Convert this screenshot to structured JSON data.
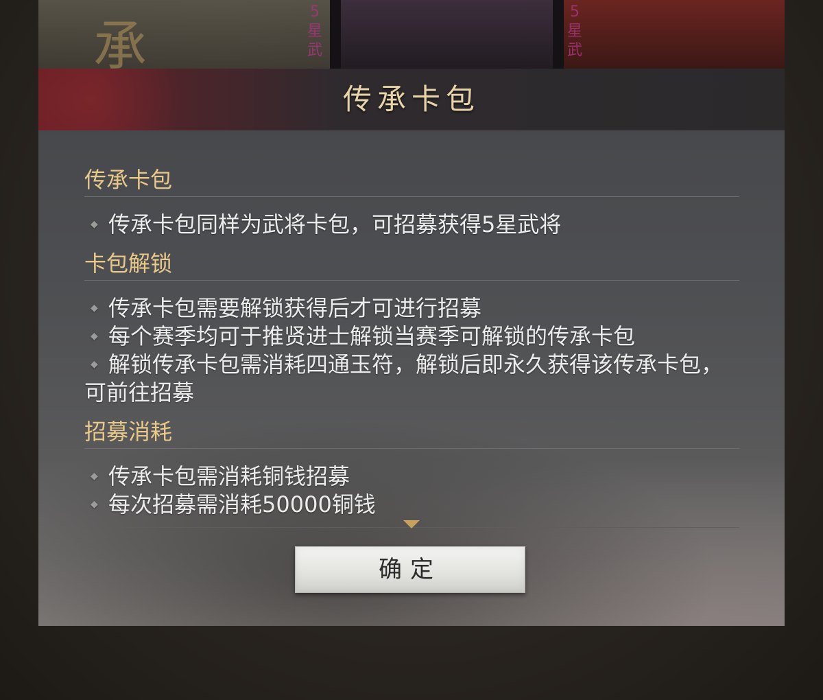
{
  "background": {
    "art_big_char": "承",
    "art_side_text_1": "5星武",
    "art_side_text_2": "5星武"
  },
  "dialog": {
    "title": "传承卡包",
    "sections": [
      {
        "title": "传承卡包",
        "items": [
          "传承卡包同样为武将卡包，可招募获得5星武将"
        ]
      },
      {
        "title": "卡包解锁",
        "items": [
          "传承卡包需要解锁获得后才可进行招募",
          "每个赛季均可于推贤进士解锁当赛季可解锁的传承卡包",
          "解锁传承卡包需消耗四通玉符，解锁后即永久获得该传承卡包，可前往招募"
        ]
      },
      {
        "title": "招募消耗",
        "items": [
          "传承卡包需消耗铜钱招募",
          "每次招募需消耗50000铜钱"
        ]
      }
    ],
    "bullet_icon": "◆",
    "confirm_label": "确定"
  },
  "colors": {
    "section_title": "#e9c98a",
    "title_gold": "#e7d4a8",
    "header_red": "#6b2025",
    "body_text": "#ececec"
  }
}
